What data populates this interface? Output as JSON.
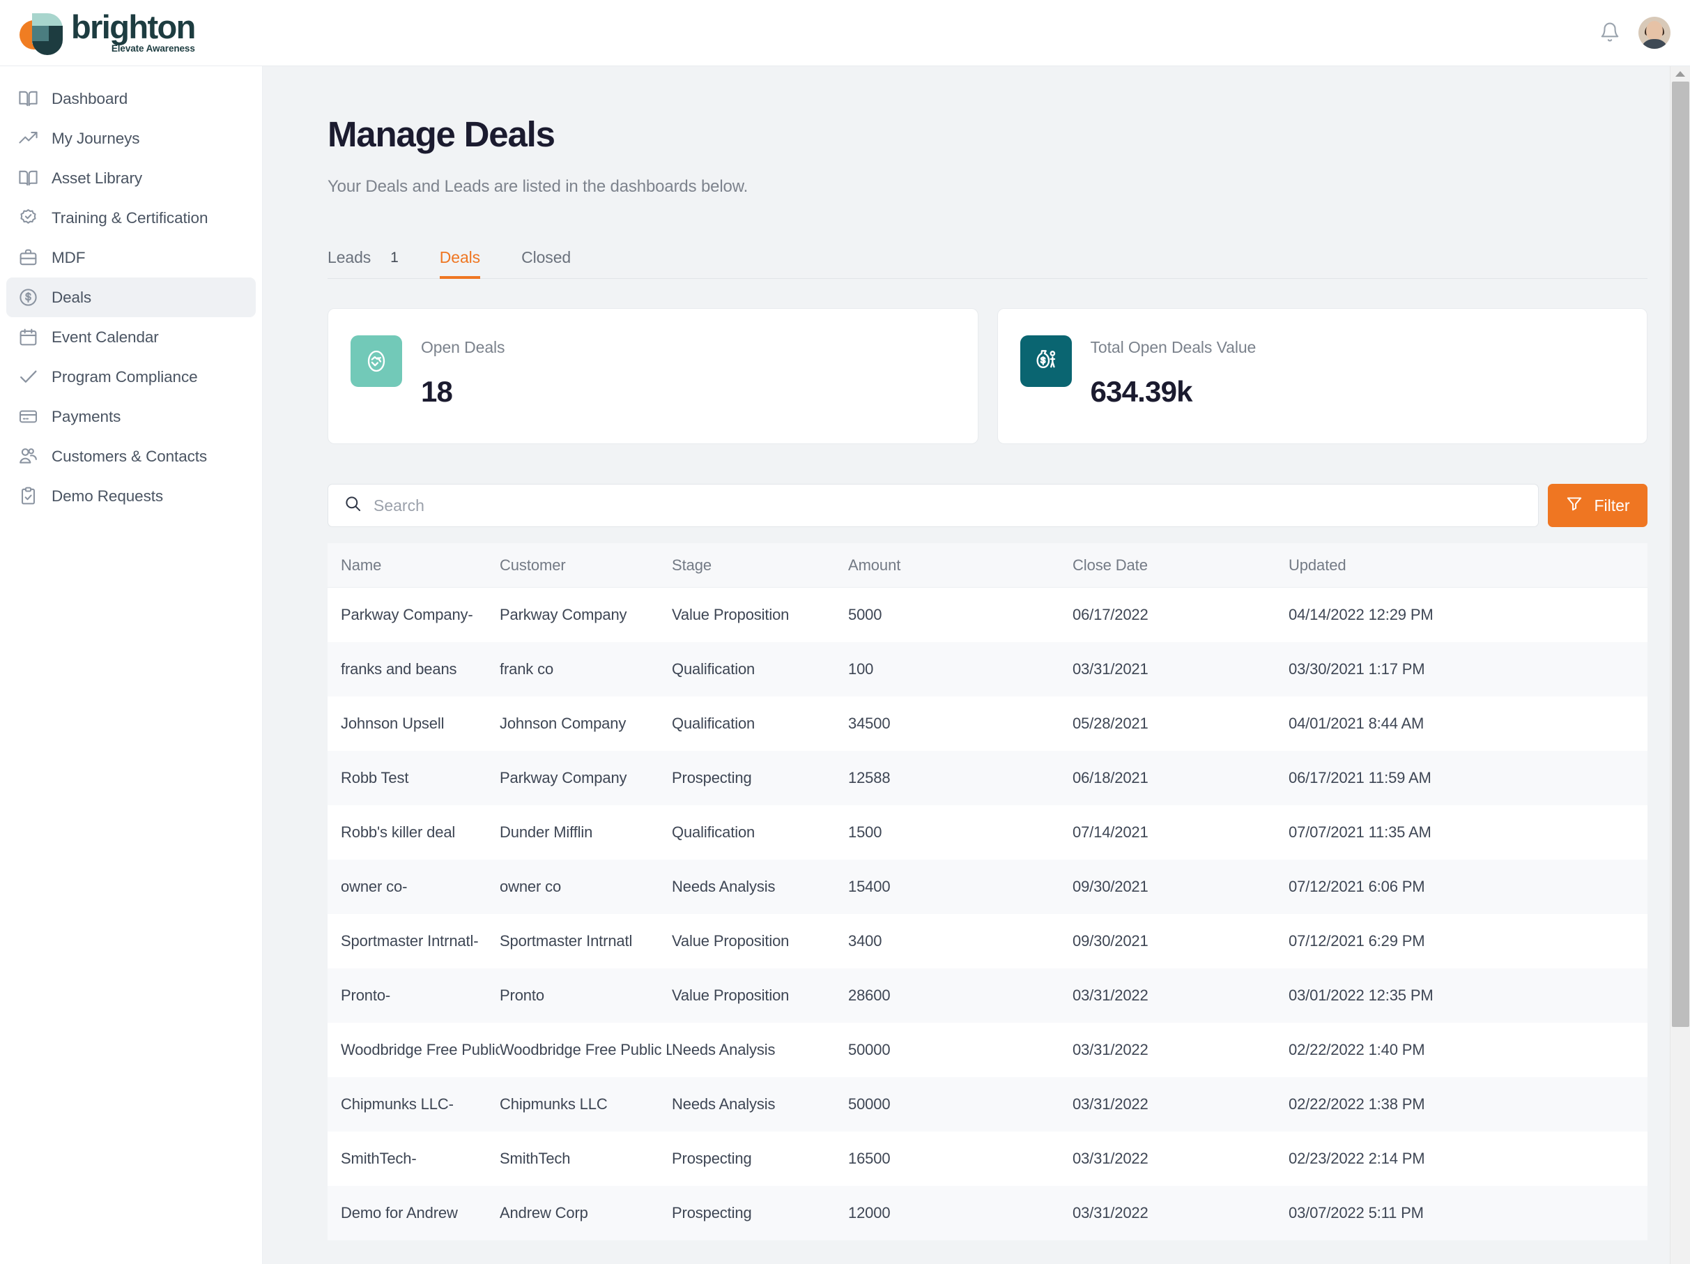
{
  "brand": {
    "name": "brighton",
    "tagline": "Elevate Awareness"
  },
  "topbar": {
    "notifications_icon": "bell-icon",
    "avatar_alt": "User avatar"
  },
  "sidebar": {
    "items": [
      {
        "label": "Dashboard",
        "icon": "book-icon",
        "active": false
      },
      {
        "label": "My Journeys",
        "icon": "trending-up-icon",
        "active": false
      },
      {
        "label": "Asset Library",
        "icon": "book-icon",
        "active": false
      },
      {
        "label": "Training & Certification",
        "icon": "badge-check-icon",
        "active": false
      },
      {
        "label": "MDF",
        "icon": "briefcase-icon",
        "active": false
      },
      {
        "label": "Deals",
        "icon": "dollar-circle-icon",
        "active": true
      },
      {
        "label": "Event Calendar",
        "icon": "calendar-icon",
        "active": false
      },
      {
        "label": "Program Compliance",
        "icon": "check-icon",
        "active": false
      },
      {
        "label": "Payments",
        "icon": "credit-card-icon",
        "active": false
      },
      {
        "label": "Customers & Contacts",
        "icon": "users-icon",
        "active": false
      },
      {
        "label": "Demo Requests",
        "icon": "clipboard-check-icon",
        "active": false
      }
    ]
  },
  "page": {
    "title": "Manage Deals",
    "subtitle": "Your Deals and Leads are listed in the dashboards below."
  },
  "tabs": [
    {
      "label": "Leads",
      "badge": "1",
      "active": false
    },
    {
      "label": "Deals",
      "badge": "",
      "active": true
    },
    {
      "label": "Closed",
      "badge": "",
      "active": false
    }
  ],
  "cards": [
    {
      "label": "Open Deals",
      "value": "18",
      "icon": "handshake-icon",
      "color": "#72c9b8"
    },
    {
      "label": "Total Open Deals Value",
      "value": "634.39k",
      "icon": "money-bag-icon",
      "color": "#0a6571"
    }
  ],
  "search": {
    "placeholder": "Search",
    "value": "",
    "icon": "search-icon"
  },
  "filter": {
    "label": "Filter",
    "icon": "funnel-icon",
    "color": "#ef7622"
  },
  "table": {
    "columns": [
      "Name",
      "Customer",
      "Stage",
      "Amount",
      "Close Date",
      "Updated"
    ],
    "rows": [
      [
        "Parkway Company-",
        "Parkway Company",
        "Value Proposition",
        "5000",
        "06/17/2022",
        "04/14/2022 12:29 PM"
      ],
      [
        "franks and beans",
        "frank co",
        "Qualification",
        "100",
        "03/31/2021",
        "03/30/2021 1:17 PM"
      ],
      [
        "Johnson Upsell",
        "Johnson Company",
        "Qualification",
        "34500",
        "05/28/2021",
        "04/01/2021 8:44 AM"
      ],
      [
        "Robb Test",
        "Parkway Company",
        "Prospecting",
        "12588",
        "06/18/2021",
        "06/17/2021 11:59 AM"
      ],
      [
        "Robb's killer deal",
        "Dunder Mifflin",
        "Qualification",
        "1500",
        "07/14/2021",
        "07/07/2021 11:35 AM"
      ],
      [
        "owner co-",
        "owner co",
        "Needs Analysis",
        "15400",
        "09/30/2021",
        "07/12/2021 6:06 PM"
      ],
      [
        "Sportmaster Intrnatl-",
        "Sportmaster Intrnatl",
        "Value Proposition",
        "3400",
        "09/30/2021",
        "07/12/2021 6:29 PM"
      ],
      [
        "Pronto-",
        "Pronto",
        "Value Proposition",
        "28600",
        "03/31/2022",
        "03/01/2022 12:35 PM"
      ],
      [
        "Woodbridge Free Public Library",
        "Woodbridge Free Public Library",
        "Needs Analysis",
        "50000",
        "03/31/2022",
        "02/22/2022 1:40 PM"
      ],
      [
        "Chipmunks LLC-",
        "Chipmunks LLC",
        "Needs Analysis",
        "50000",
        "03/31/2022",
        "02/22/2022 1:38 PM"
      ],
      [
        "SmithTech-",
        "SmithTech",
        "Prospecting",
        "16500",
        "03/31/2022",
        "02/23/2022 2:14 PM"
      ],
      [
        "Demo for Andrew",
        "Andrew Corp",
        "Prospecting",
        "12000",
        "03/31/2022",
        "03/07/2022 5:11 PM"
      ]
    ]
  },
  "scrollbar": {
    "up_icon": "scroll-up-arrow-icon"
  }
}
